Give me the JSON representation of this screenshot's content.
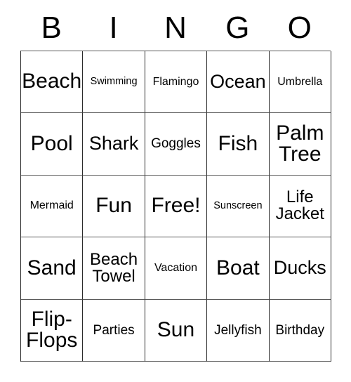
{
  "card": {
    "header_letters": [
      "B",
      "I",
      "N",
      "G",
      "O"
    ],
    "grid_rows": [
      [
        {
          "label": "Beach",
          "size": "s-xxl"
        },
        {
          "label": "Swimming",
          "size": "s-xs"
        },
        {
          "label": "Flamingo",
          "size": "s-s"
        },
        {
          "label": "Ocean",
          "size": "s-xl"
        },
        {
          "label": "Umbrella",
          "size": "s-s"
        }
      ],
      [
        {
          "label": "Pool",
          "size": "s-xxl"
        },
        {
          "label": "Shark",
          "size": "s-xl"
        },
        {
          "label": "Goggles",
          "size": "s-m"
        },
        {
          "label": "Fish",
          "size": "s-xxl"
        },
        {
          "label": "Palm Tree",
          "size": "s-xxl two-line"
        }
      ],
      [
        {
          "label": "Mermaid",
          "size": "s-s"
        },
        {
          "label": "Fun",
          "size": "s-xxl"
        },
        {
          "label": "Free!",
          "size": "s-xxl"
        },
        {
          "label": "Sunscreen",
          "size": "s-xs"
        },
        {
          "label": "Life Jacket",
          "size": "s-l two-line"
        }
      ],
      [
        {
          "label": "Sand",
          "size": "s-xxl"
        },
        {
          "label": "Beach Towel",
          "size": "s-l two-line"
        },
        {
          "label": "Vacation",
          "size": "s-s"
        },
        {
          "label": "Boat",
          "size": "s-xxl"
        },
        {
          "label": "Ducks",
          "size": "s-xl"
        }
      ],
      [
        {
          "label": "Flip-Flops",
          "size": "s-xxl two-line"
        },
        {
          "label": "Parties",
          "size": "s-m"
        },
        {
          "label": "Sun",
          "size": "s-xxl"
        },
        {
          "label": "Jellyfish",
          "size": "s-m"
        },
        {
          "label": "Birthday",
          "size": "s-m"
        }
      ]
    ],
    "colors": {
      "background": "#ffffff",
      "text": "#000000",
      "border_dark": "#2b2b2b",
      "border_light": "#5a5a5a"
    }
  }
}
